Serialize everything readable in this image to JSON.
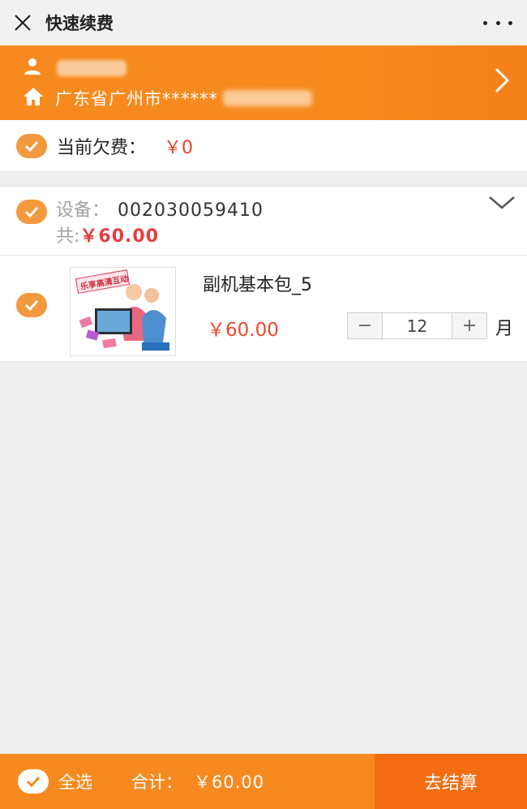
{
  "nav": {
    "title": "快速续费"
  },
  "user": {
    "address": "广东省广州市******"
  },
  "debt": {
    "label": "当前欠费：",
    "value": "￥0"
  },
  "device": {
    "label": "设备：",
    "id": "002030059410",
    "total_label": "共:",
    "total": "￥60.00"
  },
  "product": {
    "name": "副机基本包_5",
    "price": "￥60.00",
    "quantity": "12",
    "unit": "月",
    "minus": "−",
    "plus": "+",
    "image_text": "乐享高清互动"
  },
  "footer": {
    "select_all": "全选",
    "total_label": "合计：",
    "total": "￥60.00",
    "checkout": "去结算"
  },
  "colors": {
    "accent": "#f68a20",
    "checkout": "#f46d12",
    "price_red": "#e8442d"
  }
}
